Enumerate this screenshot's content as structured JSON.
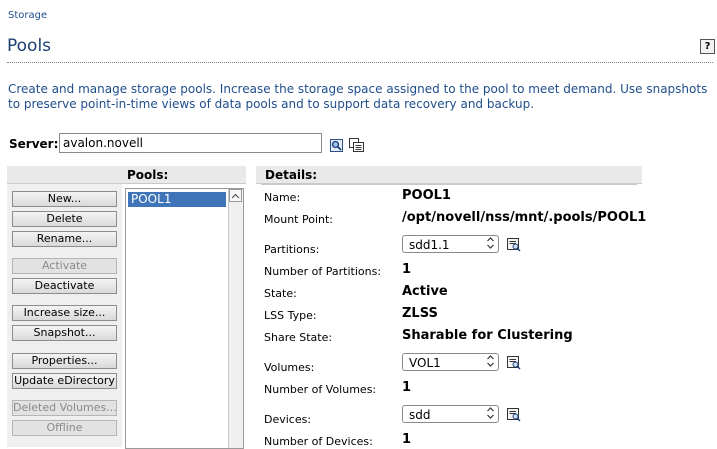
{
  "breadcrumb": "Storage",
  "page_title": "Pools",
  "help_label": "?",
  "description": "Create and manage storage pools. Increase the storage space assigned to the pool to meet demand. Use snapshots to preserve point-in-time views of data pools and to support data recovery and backup.",
  "server": {
    "label": "Server:",
    "value": "avalon.novell"
  },
  "columns": {
    "pools": "Pools:",
    "details": "Details:"
  },
  "buttons": {
    "new": "New...",
    "delete": "Delete",
    "rename": "Rename...",
    "activate": "Activate",
    "deactivate": "Deactivate",
    "increase_size": "Increase size...",
    "snapshot": "Snapshot...",
    "properties": "Properties...",
    "update_edirectory": "Update eDirectory",
    "deleted_volumes": "Deleted Volumes...",
    "offline": "Offline"
  },
  "pools_list": [
    "POOL1"
  ],
  "details": {
    "name_label": "Name:",
    "name_value": "POOL1",
    "mount_label": "Mount Point:",
    "mount_value": "/opt/novell/nss/mnt/.pools/POOL1",
    "partitions_label": "Partitions:",
    "partitions_selected": "sdd1.1",
    "num_partitions_label": "Number of Partitions:",
    "num_partitions_value": "1",
    "state_label": "State:",
    "state_value": "Active",
    "lss_label": "LSS Type:",
    "lss_value": "ZLSS",
    "share_label": "Share State:",
    "share_value": "Sharable for Clustering",
    "volumes_label": "Volumes:",
    "volumes_selected": "VOL1",
    "num_volumes_label": "Number of Volumes:",
    "num_volumes_value": "1",
    "devices_label": "Devices:",
    "devices_selected": "sdd",
    "num_devices_label": "Number of Devices:",
    "num_devices_value": "1"
  },
  "icons": {
    "server_browse": "search-icon",
    "server_history": "history-list-icon",
    "details_view": "details-view-icon"
  },
  "colors": {
    "title": "#1c3f73",
    "link_text": "#1f4e8c",
    "selection": "#3f74b8"
  }
}
